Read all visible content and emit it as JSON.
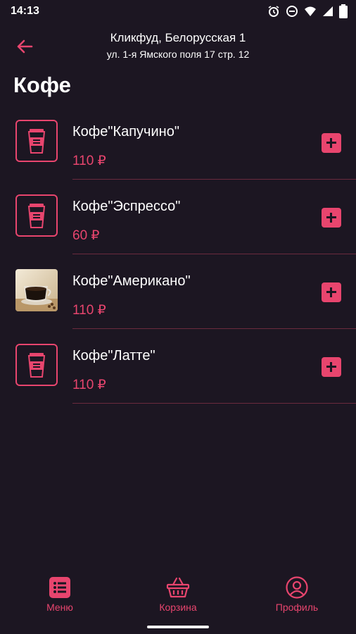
{
  "status_bar": {
    "time": "14:13",
    "icons": [
      "alarm-icon",
      "do-not-disturb-icon",
      "wifi-icon",
      "signal-icon",
      "battery-icon"
    ]
  },
  "header": {
    "title": "Кликфуд, Белорусская 1",
    "subtitle": "ул. 1-я Ямского поля 17 стр. 12"
  },
  "page": {
    "title": "Кофе"
  },
  "products": [
    {
      "name": "Кофе\"Капучино\"",
      "price": "110 ₽",
      "image": "coffee-cup-icon"
    },
    {
      "name": "Кофе\"Эспрессо\"",
      "price": "60 ₽",
      "image": "coffee-cup-icon"
    },
    {
      "name": "Кофе\"Американо\"",
      "price": "110 ₽",
      "image": "americano-photo"
    },
    {
      "name": "Кофе\"Латте\"",
      "price": "110 ₽",
      "image": "coffee-cup-icon"
    }
  ],
  "nav": {
    "menu": "Меню",
    "cart": "Корзина",
    "profile": "Профиль"
  },
  "colors": {
    "background": "#1c1622",
    "accent": "#e8456e",
    "text": "#ffffff"
  }
}
